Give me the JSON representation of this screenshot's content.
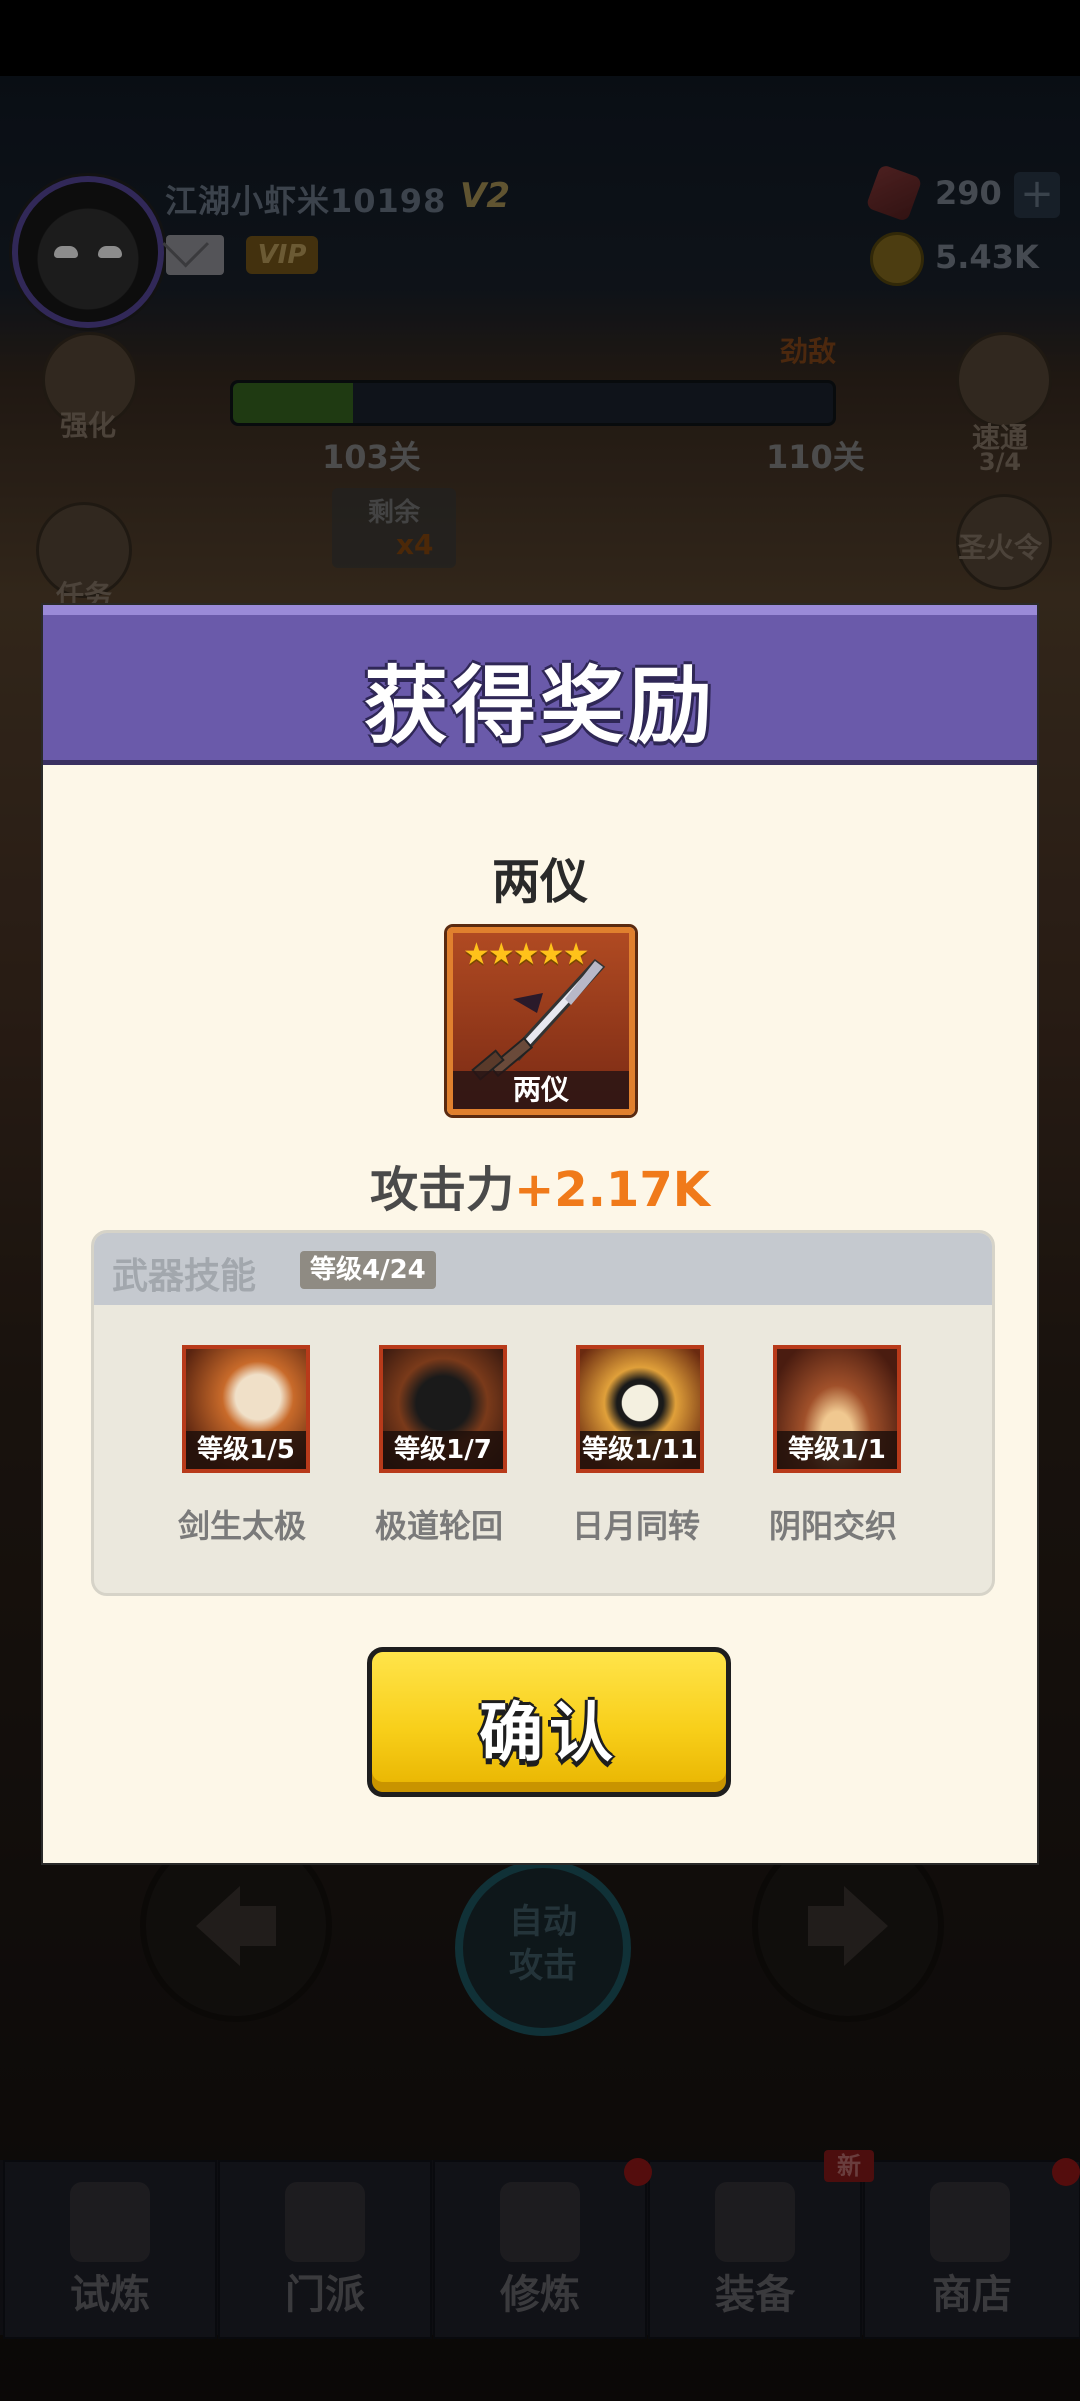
{
  "player": {
    "name": "江湖小虾米10198",
    "vip_level": "V2",
    "vip_badge": "VIP"
  },
  "currency": {
    "gems": "290",
    "coins": "5.43K",
    "plus_symbol": "+"
  },
  "side_buttons": {
    "strengthen": "强化",
    "quest": "任务",
    "wanted": "速通",
    "wanted_progress": "3/4",
    "sacred_fire": "圣火令"
  },
  "stage": {
    "current": "103关",
    "boss": "110关",
    "boss_tag": "劲敌",
    "progress": 0.2,
    "remaining_label": "剩余",
    "remaining_count": "x4"
  },
  "controls": {
    "auto_attack": "自动\n攻击"
  },
  "nav": {
    "items": [
      {
        "label": "试炼"
      },
      {
        "label": "门派"
      },
      {
        "label": "修炼"
      },
      {
        "label": "装备"
      },
      {
        "label": "商店"
      }
    ],
    "new_badge": "新"
  },
  "modal": {
    "title": "获得奖励",
    "item_name": "两仪",
    "item_card_label": "两仪",
    "stars": "★★★★★",
    "attack_label": "攻击力",
    "attack_value": "+2.17K",
    "skills_title": "武器技能",
    "skills_level": "等级4/24",
    "skills": [
      {
        "level": "等级1/5",
        "name": "剑生太极"
      },
      {
        "level": "等级1/7",
        "name": "极道轮回"
      },
      {
        "level": "等级1/11",
        "name": "日月同转"
      },
      {
        "level": "等级1/1",
        "name": "阴阳交织"
      }
    ],
    "confirm_label": "确认"
  },
  "colors": {
    "header_purple": "#6a5aaa",
    "attack_orange": "#f07a1a",
    "confirm_yellow": "#f8cf1a",
    "card_orange": "#e0802e"
  }
}
